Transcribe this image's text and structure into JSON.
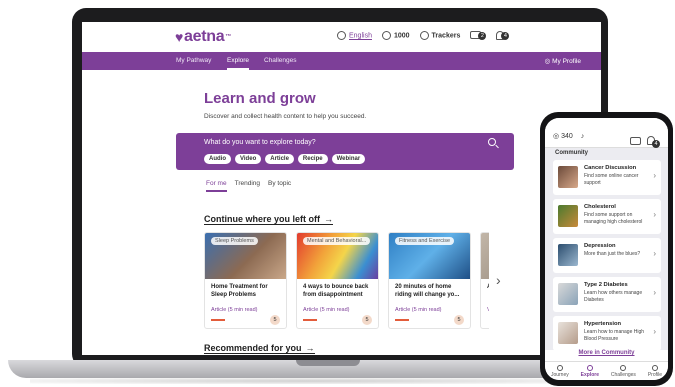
{
  "header": {
    "logo_text": "aetna",
    "logo_mark": "™",
    "language": "English",
    "points": "1000",
    "trackers": "Trackers",
    "messages_count": "2",
    "notifications_count": "4"
  },
  "nav": {
    "items": [
      {
        "label": "My Pathway"
      },
      {
        "label": "Explore"
      },
      {
        "label": "Challenges"
      }
    ],
    "profile": "My Profile"
  },
  "hero": {
    "title": "Learn and grow",
    "subtitle": "Discover and collect health content to help you succeed."
  },
  "search": {
    "question": "What do you want to explore today?",
    "chips": [
      "Audio",
      "Video",
      "Article",
      "Recipe",
      "Webinar"
    ]
  },
  "tabs": [
    "For me",
    "Trending",
    "By topic"
  ],
  "continue": {
    "title": "Continue where you left off",
    "arrow": "→",
    "cards": [
      {
        "tag": "Sleep Problems",
        "title": "Home Treatment for Sleep Problems",
        "meta": "Article (5 min read)",
        "points": "5"
      },
      {
        "tag": "Mental and Behavioral...",
        "title": "4 ways to bounce back from disappointment",
        "meta": "Article (5 min read)",
        "points": "5"
      },
      {
        "tag": "Fitness and Exercise",
        "title": "20 minutes of home riding will change yo...",
        "meta": "Article (5 min read)",
        "points": "5"
      },
      {
        "tag": "",
        "title": "A H... A...",
        "meta": "V...",
        "points": ""
      }
    ],
    "next_arrow": "›"
  },
  "recommended": {
    "title": "Recommended for you",
    "arrow": "→"
  },
  "phone": {
    "points": "340",
    "notifications_count": "4",
    "section": "Community",
    "items": [
      {
        "title": "Cancer Discussion",
        "desc": "Find some online cancer support"
      },
      {
        "title": "Cholesterol",
        "desc": "Find some support on managing high cholesterol"
      },
      {
        "title": "Depression",
        "desc": "More than just the blues?"
      },
      {
        "title": "Type 2 Diabetes",
        "desc": "Learn how others manage Diabetes"
      },
      {
        "title": "Hypertension",
        "desc": "Learn how to manage High Blood Pressure"
      }
    ],
    "more_link": "More in Community",
    "tabs": [
      {
        "label": "Journey"
      },
      {
        "label": "Explore"
      },
      {
        "label": "Challenges"
      },
      {
        "label": "Profile"
      }
    ]
  },
  "colors": {
    "brand": "#7d3f98",
    "accent": "#e35c3b"
  }
}
